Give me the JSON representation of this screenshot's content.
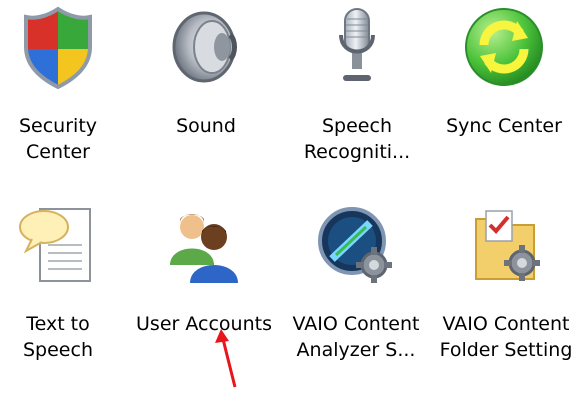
{
  "control_panel": {
    "items": [
      {
        "line1": "Security",
        "line2": "Center",
        "icon": "shield-icon"
      },
      {
        "line1": "Sound",
        "line2": "",
        "icon": "speaker-icon"
      },
      {
        "line1": "Speech",
        "line2": "Recogniti...",
        "icon": "microphone-icon"
      },
      {
        "line1": "Sync Center",
        "line2": "",
        "icon": "sync-icon"
      },
      {
        "line1": "Text to",
        "line2": "Speech",
        "icon": "speech-bubble-document-icon"
      },
      {
        "line1": "User Accounts",
        "line2": "",
        "icon": "users-icon"
      },
      {
        "line1": "VAIO Content",
        "line2": "Analyzer S...",
        "icon": "vaio-analyzer-icon"
      },
      {
        "line1": "VAIO Content",
        "line2": "Folder Setting",
        "icon": "folder-gear-icon"
      }
    ]
  },
  "colors": {
    "arrow": "#e8161b",
    "sync_green": "#4cc23a",
    "folder_yellow": "#f3cf6b"
  }
}
